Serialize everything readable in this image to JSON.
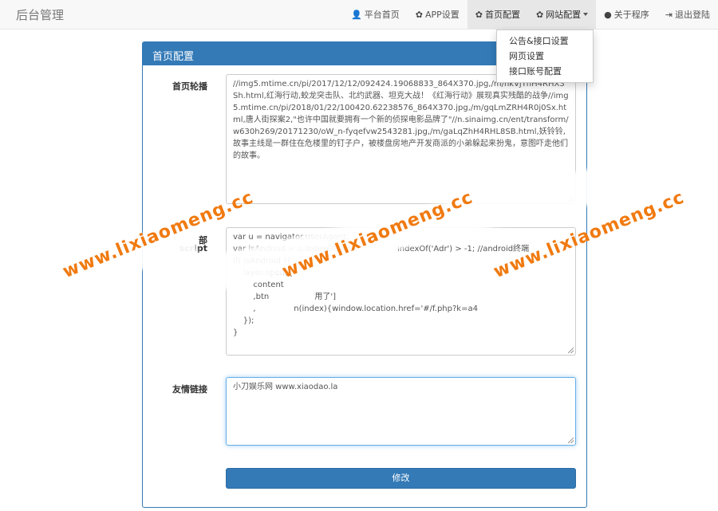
{
  "navbar": {
    "brand": "后台管理",
    "items": [
      {
        "icon": "user-icon",
        "glyph": "👤",
        "label": "平台首页"
      },
      {
        "icon": "gear-icon",
        "glyph": "✿",
        "label": "APP设置"
      },
      {
        "icon": "gear-icon",
        "glyph": "✿",
        "label": "首页配置"
      },
      {
        "icon": "gear-icon",
        "glyph": "✿",
        "label": "网站配置"
      },
      {
        "icon": "lightbulb-icon",
        "glyph": "●",
        "label": "关于程序"
      },
      {
        "icon": "logout-icon",
        "glyph": "⇥",
        "label": "退出登陆"
      }
    ]
  },
  "dropdown": {
    "items": [
      "公告&接口设置",
      "网页设置",
      "接口账号配置"
    ]
  },
  "panel": {
    "title": "首页配置"
  },
  "form": {
    "carousel_label": "首页轮播",
    "carousel_value": "//img5.mtime.cn/pi/2017/12/12/092424.19068833_864X370.jpg,/m/hkVjYnH4RHX3Sh.html,红海行动,蛟龙突击队、北约武器、坦克大战！《红海行动》展现真实残酷的战争//img5.mtime.cn/pi/2018/01/22/100420.62238576_864X370.jpg,/m/gqLmZRH4R0j0Sx.html,唐人街探案2,\"也许中国就要拥有一个新的侦探电影品牌了\"//n.sinaimg.cn/ent/transform/w630h269/20171230/oW_n-fyqefvw2543281.jpg,/m/gaLqZhH4RHL8SB.html,妖铃铃,故事主线是一群住在危楼里的钉子户，被楼盘房地产开发商派的小弟躲起来扮鬼，意图吓走他们的故事。",
    "script_label_1": "部",
    "script_label_2": "script",
    "script_lines": [
      "var u = navigator.userAgent;",
      "var isAndroid = u.indexOf('And                indexOf('Adr') > -1; //android终端",
      "if( isAndroid ){",
      "    layer.open({",
      "        content",
      "        ,btn                  用了']",
      "        ,               n(index){window.location.href='#/f.php?k=a4",
      "    });",
      "}"
    ],
    "links_label": "友情链接",
    "links_value": "小刀娱乐网 www.xiaodao.la",
    "submit_label": "修改"
  },
  "watermark": {
    "text": "www.lixiaomeng.cc",
    "color": "#f07a10"
  },
  "colors": {
    "primary": "#337ab7",
    "navbar_bg": "#f8f8f8",
    "focus": "#66afe9"
  }
}
